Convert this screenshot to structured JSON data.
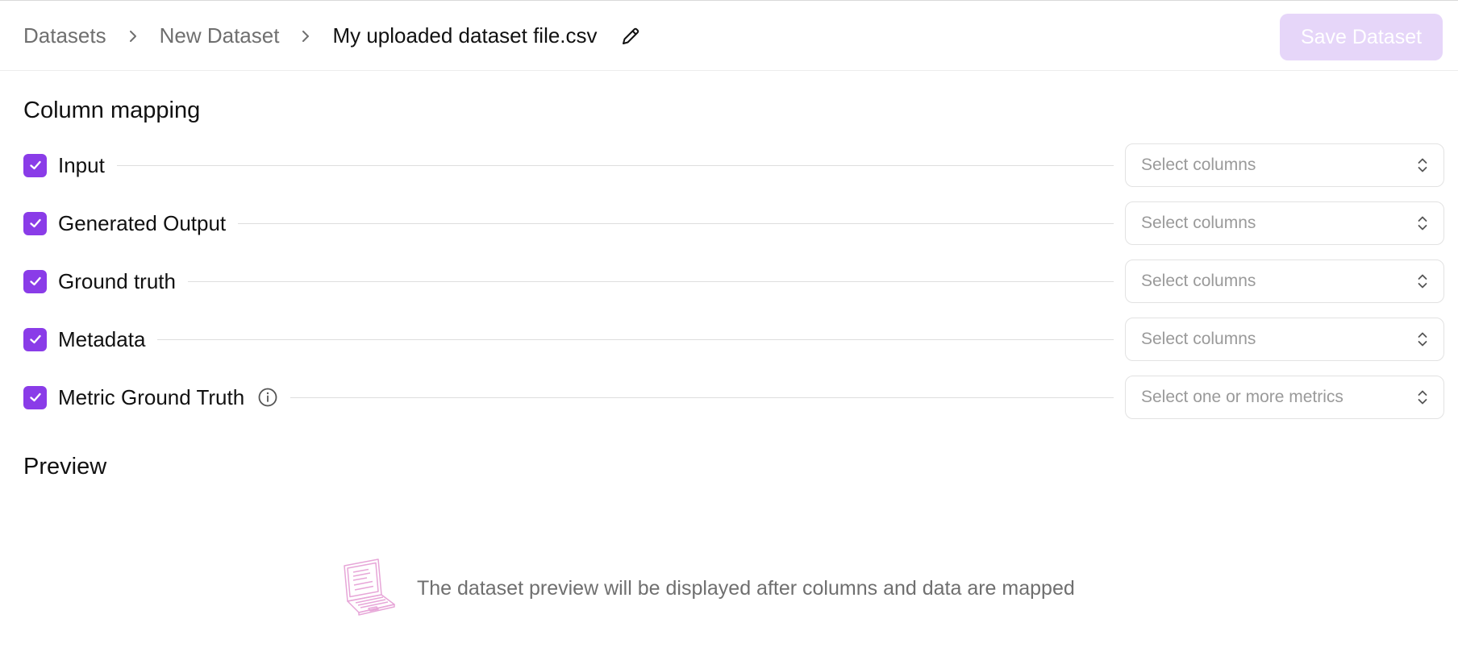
{
  "breadcrumb": {
    "items": [
      {
        "label": "Datasets"
      },
      {
        "label": "New Dataset"
      }
    ],
    "current": "My uploaded dataset file.csv"
  },
  "header": {
    "save_label": "Save Dataset"
  },
  "column_mapping": {
    "title": "Column mapping",
    "rows": [
      {
        "label": "Input",
        "checked": true,
        "placeholder": "Select columns"
      },
      {
        "label": "Generated Output",
        "checked": true,
        "placeholder": "Select columns"
      },
      {
        "label": "Ground truth",
        "checked": true,
        "placeholder": "Select columns"
      },
      {
        "label": "Metadata",
        "checked": true,
        "placeholder": "Select columns"
      },
      {
        "label": "Metric Ground Truth",
        "checked": true,
        "placeholder": "Select one or more metrics",
        "has_info_icon": true
      }
    ]
  },
  "preview": {
    "title": "Preview",
    "empty_message": "The dataset preview will be displayed after columns and data are mapped"
  },
  "icons": {
    "breadcrumb_separator": "chevron-right-icon",
    "edit": "pencil-icon",
    "checkbox": "check-icon",
    "select": "chevron-up-down-icon",
    "info": "info-icon",
    "empty": "laptop-illustration-icon"
  },
  "colors": {
    "accent": "#8a3ce8",
    "save_button_disabled": "#e6d6f9",
    "muted_text": "#6f6f6f",
    "placeholder_text": "#9a9a9a",
    "divider": "#dedede",
    "illustration": "#e7a6d8"
  }
}
